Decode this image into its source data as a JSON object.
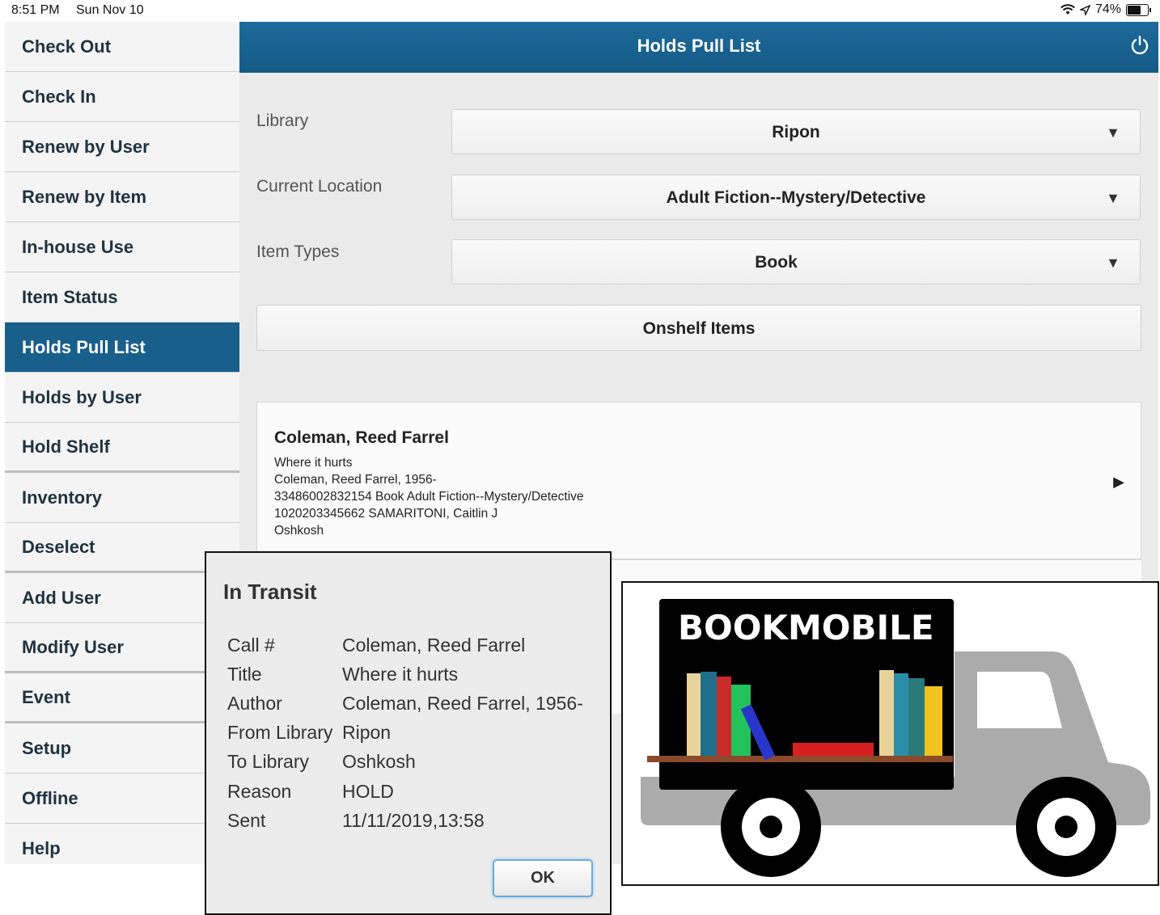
{
  "status_bar": {
    "time": "8:51 PM",
    "date": "Sun Nov 10",
    "battery": "74%"
  },
  "sidebar": {
    "items": [
      {
        "label": "Check Out"
      },
      {
        "label": "Check In"
      },
      {
        "label": "Renew by User"
      },
      {
        "label": "Renew by Item"
      },
      {
        "label": "In-house Use"
      },
      {
        "label": "Item Status"
      },
      {
        "label": "Holds Pull List"
      },
      {
        "label": "Holds by User"
      },
      {
        "label": "Hold Shelf"
      },
      {
        "label": "Inventory"
      },
      {
        "label": "Deselect"
      },
      {
        "label": "Add User"
      },
      {
        "label": "Modify User"
      },
      {
        "label": "Event"
      },
      {
        "label": "Setup"
      },
      {
        "label": "Offline"
      },
      {
        "label": "Help"
      }
    ],
    "active": "Holds Pull List"
  },
  "header": {
    "title": "Holds Pull List"
  },
  "form": {
    "library_label": "Library",
    "library_value": "Ripon",
    "location_label": "Current Location",
    "location_value": "Adult Fiction--Mystery/Detective",
    "item_types_label": "Item Types",
    "item_types_value": "Book",
    "onshelf_button": "Onshelf Items"
  },
  "result": {
    "name": "Coleman, Reed Farrel",
    "lines": [
      "Where it hurts",
      "Coleman, Reed Farrel, 1956-",
      "33486002832154 Book Adult Fiction--Mystery/Detective",
      "1020203345662 SAMARITONI, Caitlin J",
      "Oshkosh"
    ]
  },
  "dialog": {
    "title": "In Transit",
    "rows": [
      {
        "key": "Call #",
        "value": "Coleman, Reed Farrel"
      },
      {
        "key": "Title",
        "value": "Where it hurts"
      },
      {
        "key": "Author",
        "value": "Coleman, Reed Farrel, 1956-"
      },
      {
        "key": "From Library",
        "value": "Ripon"
      },
      {
        "key": "To Library",
        "value": "Oshkosh"
      },
      {
        "key": "Reason",
        "value": "HOLD"
      },
      {
        "key": "Sent",
        "value": "11/11/2019,13:58"
      }
    ],
    "ok_label": "OK"
  },
  "bookmobile": {
    "sign": "BOOKMOBILE"
  },
  "colors": {
    "header": "#195f8c",
    "active_sidebar": "#195f8c",
    "ok_border": "#6ea9d8"
  }
}
